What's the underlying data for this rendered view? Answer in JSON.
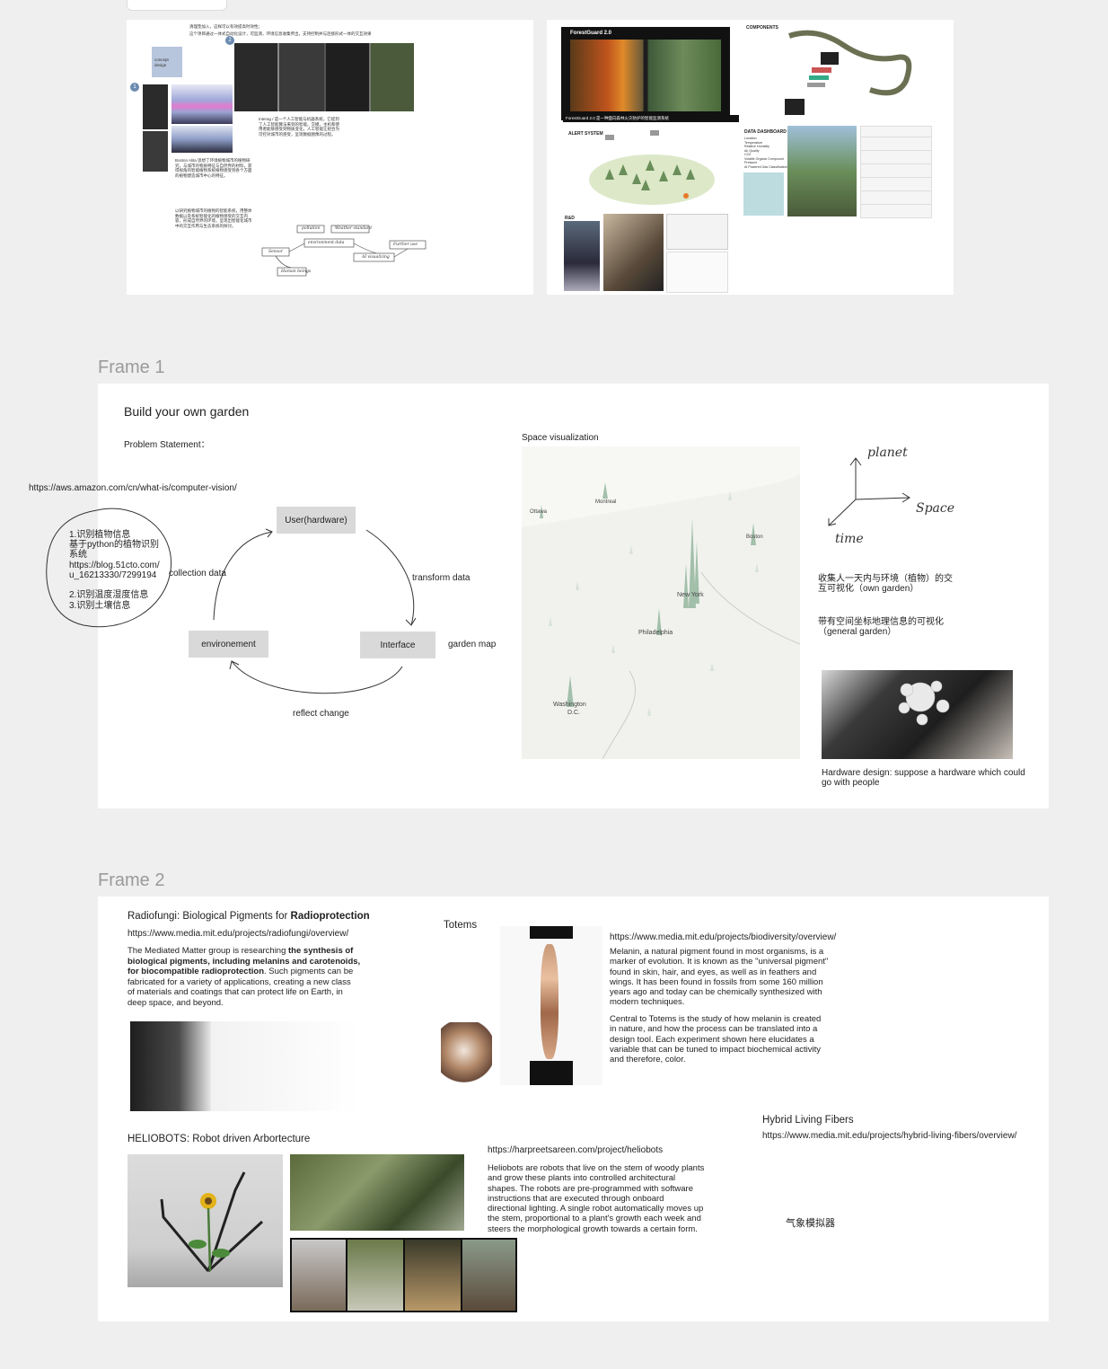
{
  "frames": {
    "frame1_title": "Frame 1",
    "frame2_title": "Frame 2"
  },
  "top_left_panel": {
    "note_line1": "清理垫加入，这样可以有效提高时效性；",
    "note_line2": "这个项目通过一体式自动化设计，可监测，环境信息收集传出，支持控制并与连接形式一体的交互效果",
    "concept_note": "concept design",
    "marker_1": "1",
    "marker_2": "2",
    "body_text_a": "Interag / 是一个人工智能与机器系统，它提到了人工智能算法来到的智能。交模，主机和使用者能够感受到物质变化，人工智能让组合为可控对城市的感受，呈现数据图像的过程。",
    "body_text_b": "Boston Alita 思想了环境植物城市的植物研究，与城市的物质特征与自然界的材料，获得视角的智能植物系统植物感受到各个方面的植物建造城市中心的特征。",
    "body_text_c": "以研究植物城市的植物的智能系统，用整体数据以及系统智能化的植物感受的交互内容，形成自然界的环境，呈现出智能化城市中的交互作用与生态系统的探讨。",
    "flow_pollution": "pollution",
    "flow_weather": "Weather standard",
    "flow_env_data": "environment data",
    "flow_sensor": "Sensor",
    "flow_visualizing": "AI visualizing",
    "flow_further": "Further use",
    "flow_human": "Human beings"
  },
  "top_right_panel": {
    "brand": "ForestGuard 2.0",
    "caption": "ForestGuard 2.0 是一种面向森林火灾防护的智能监测系统",
    "components_title": "COMPONENTS",
    "alert_title": "ALERT SYSTEM",
    "dashboard_title": "DATA DASHBOARD",
    "rd_title": "R&D",
    "dashboard_items": [
      "Location",
      "Temperature",
      "Relative Humidity",
      "Air Quality",
      "CO2",
      "Volatile Organic Compound",
      "Pressure",
      "AI Powered Gas Classification"
    ]
  },
  "frame1": {
    "heading": "Build your own garden",
    "problem_label": "Problem Statement：",
    "link": "https://aws.amazon.com/cn/what-is/computer-vision/",
    "list_line1": "1.识别植物信息",
    "list_line2": "基于python的植物识别",
    "list_line3": "系统",
    "list_line4": "https://blog.51cto.com/",
    "list_line5": "u_16213330/7299194",
    "list_line6": "2.识别温度湿度信息",
    "list_line7": "3.识别土壤信息",
    "node_user": "User(hardware)",
    "node_env": "environement",
    "node_interface": "Interface",
    "edge_collection": "collection data",
    "edge_transform": "transform data",
    "edge_reflect": "reflect change",
    "garden_map": "garden map",
    "space_vis": "Space visualization",
    "map_labels": {
      "ottawa": "Ottawa",
      "montreal": "Montreal",
      "boston": "Boston",
      "newyork": "New York",
      "philadelphia": "Philadelphia",
      "washington_1": "Washington",
      "washington_2": "D.C."
    },
    "axis_planet": "planet",
    "axis_space": "Space",
    "axis_time": "time",
    "note_own_1": "收集人一天内与环境（植物）的交",
    "note_own_2": "互可视化（own garden）",
    "note_general_1": "带有空间坐标地理信息的可视化",
    "note_general_2": "（general garden）",
    "hardware_caption_1": "Hardware design: suppose a hardware which could",
    "hardware_caption_2": "go with people"
  },
  "frame2": {
    "radiofungi_title_a": "Radiofungi: Biological Pigments for ",
    "radiofungi_title_b": "Radioprotection",
    "radiofungi_link": "https://www.media.mit.edu/projects/radiofungi/overview/",
    "radiofungi_p1a": "The Mediated Matter group is researching ",
    "radiofungi_p1b": "the synthesis of",
    "radiofungi_p2": "biological pigments, including melanins and carotenoids,",
    "radiofungi_p3a": "for biocompatible radioprotection",
    "radiofungi_p3b": ". Such pigments can be",
    "radiofungi_p4": "fabricated for a variety of applications, creating a new class",
    "radiofungi_p5": "of materials and coatings that can protect life on Earth, in",
    "radiofungi_p6": "deep space, and beyond.",
    "totems_title": "Totems",
    "totems_link": "https://www.media.mit.edu/projects/biodiversity/overview/",
    "totems_p1": [
      "Melanin, a natural pigment found in most organisms, is a",
      "marker of evolution. It is known as the \"universal pigment\"",
      "found in skin, hair, and eyes, as well as in feathers and",
      "wings. It has been found in fossils from some 160 million",
      "years ago and today can be chemically synthesized with",
      "modern techniques."
    ],
    "totems_p2": [
      "Central to Totems is the study of how melanin is created",
      "in nature, and how the process can be translated into a",
      "design tool. Each experiment shown here elucidates a",
      "variable that can be tuned to impact biochemical activity",
      "and therefore, color."
    ],
    "hybrid_title": "Hybrid Living Fibers",
    "hybrid_link": "https://www.media.mit.edu/projects/hybrid-living-fibers/overview/",
    "helio_title": "HELIOBOTS: Robot driven Arbortecture",
    "helio_link": "https://harpreetsareen.com/project/heliobots",
    "helio_p": [
      "Heliobots are robots that live on the stem of woody plants",
      "and grow these plants into controlled architectural",
      "shapes. The robots are pre-programmed with software",
      "instructions that are executed through onboard",
      "directional lighting. A single robot automatically moves up",
      "the stem, proportional to a plant's growth each week and",
      "steers the morphological growth towards a certain form."
    ],
    "weather_sim": "气象模拟器"
  },
  "colors": {
    "canvas": "#efefef",
    "panel": "#ffffff",
    "node_fill": "#d9d9d9",
    "frame_title": "#9a9a9a",
    "map_green": "#5e8a6a"
  }
}
